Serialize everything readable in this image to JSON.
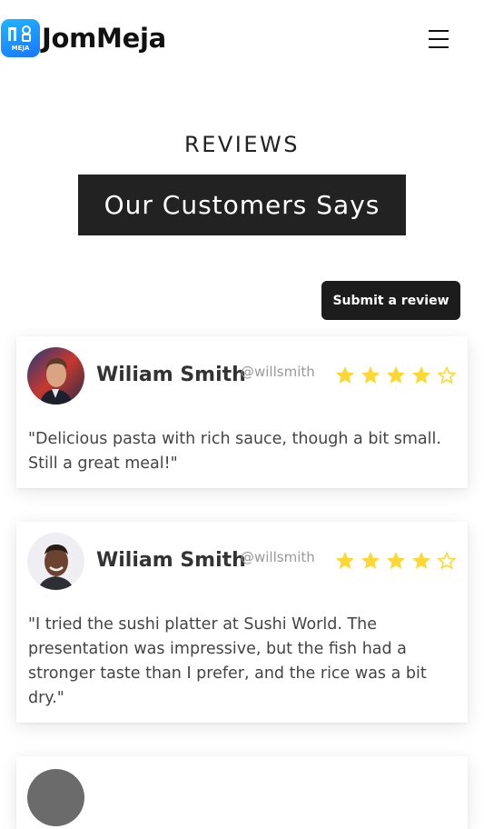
{
  "header": {
    "logo_text": "MEJA",
    "brand": "JomMeja",
    "menu_icon": "hamburger-menu-icon"
  },
  "section": {
    "label": "REVIEWS",
    "title": "Our Customers Says"
  },
  "submit_button": "Submit a review",
  "reviews": [
    {
      "name": "Wiliam Smith",
      "handle": "@willsmith",
      "rating": 4,
      "max_rating": 5,
      "text": "\"Delicious pasta with rich sauce, though a bit small. Still a great meal!\""
    },
    {
      "name": "Wiliam Smith",
      "handle": "@willsmith",
      "rating": 4,
      "max_rating": 5,
      "text": "\"I tried the sushi platter at Sushi World. The presentation was impressive, but the fish had a stronger taste than I prefer, and the rice was a bit dry.\""
    }
  ],
  "colors": {
    "star": "#fdd835",
    "title_bg": "#222222",
    "button_bg": "#1c1c1c",
    "logo_gradient_start": "#1fb6ff",
    "logo_gradient_end": "#1976ff"
  }
}
